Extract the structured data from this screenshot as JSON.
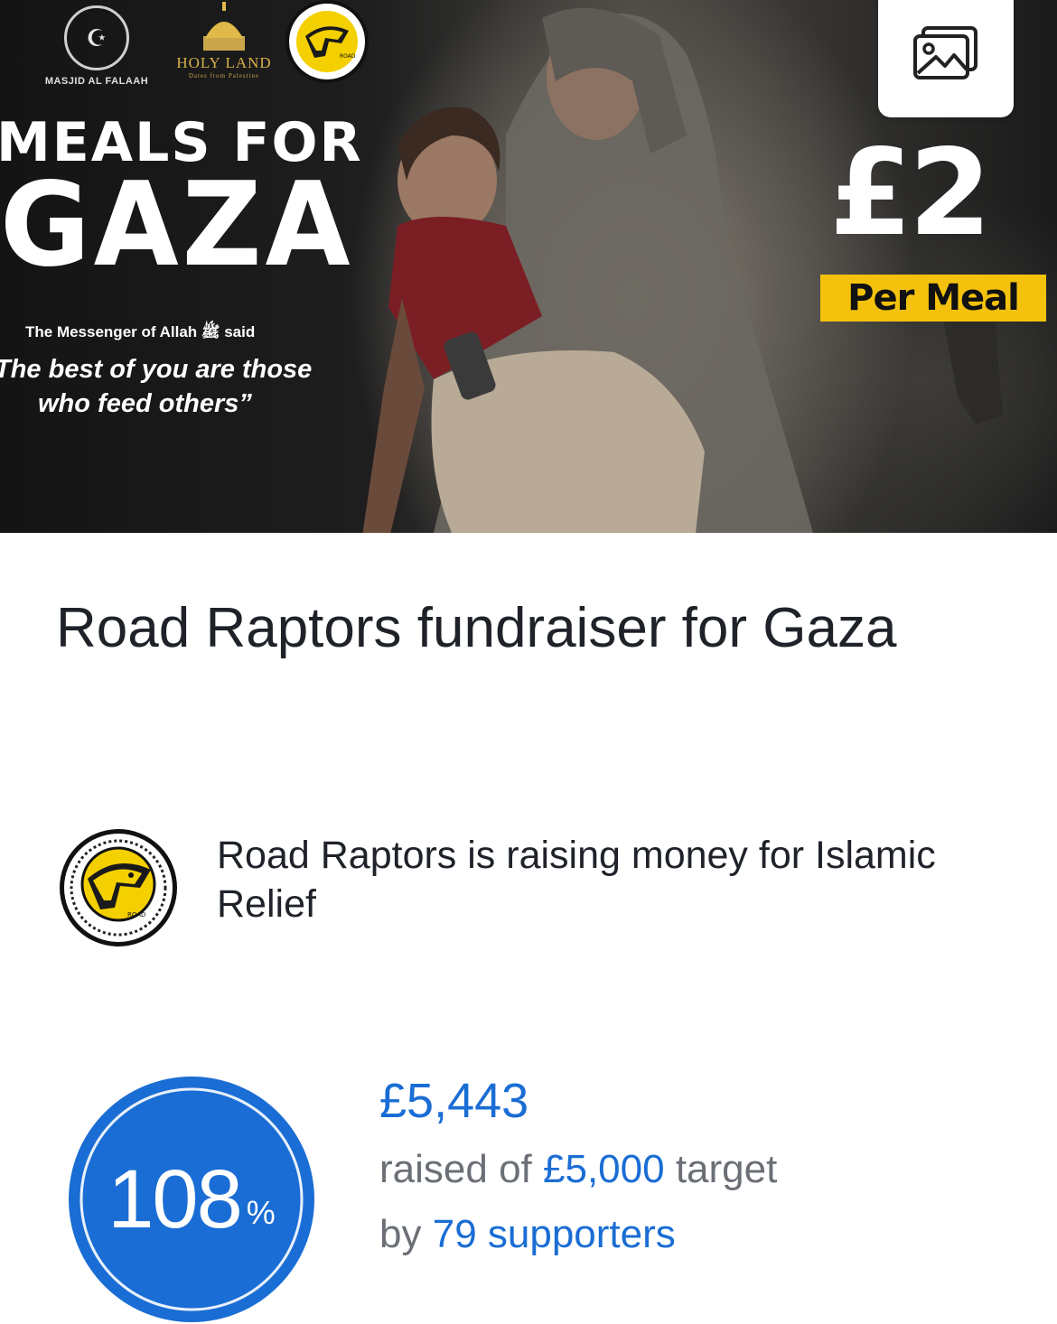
{
  "hero": {
    "masjid_name": "MASJID AL FALAAH",
    "holy_land_name": "HOLY LAND",
    "holy_land_sub": "Dates from Palestine",
    "raptor_logo_text": "ROAD RAPTORS",
    "meals_for": "MEALS FOR",
    "gaza": "GAZA",
    "messenger": "The Messenger of Allah ﷺ said",
    "quote_line1": "The best of you are those",
    "quote_line2": "who feed others”",
    "price": "£2",
    "per_meal": "Per Meal",
    "gallery_icon": "gallery-icon"
  },
  "fundraiser": {
    "title": "Road Raptors fundraiser for Gaza",
    "organiser_text": "Road Raptors is raising money for Islamic Relief",
    "avatar_text": "ROAD RAPTORS",
    "raised": "£5,443",
    "raised_prefix": "raised of",
    "target": "£5,000",
    "target_suffix": "target",
    "by_prefix": "by",
    "supporters": "79 supporters",
    "progress_percent": "108",
    "percent_symbol": "%",
    "progress_fraction": 1.08
  },
  "colors": {
    "accent_blue": "#1a6dd4",
    "badge_yellow": "#f4c20d",
    "text_dark": "#1f2329",
    "text_grey": "#6b6f76"
  }
}
